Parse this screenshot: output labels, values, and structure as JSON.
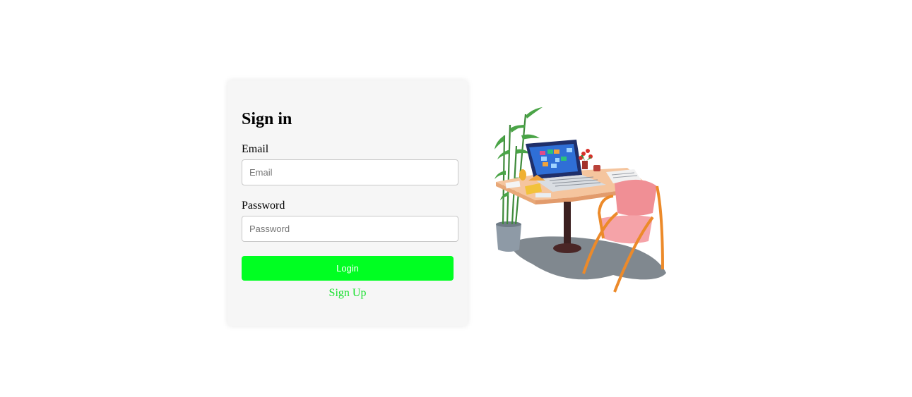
{
  "signin": {
    "title": "Sign in",
    "email_label": "Email",
    "email_placeholder": "Email",
    "email_value": "",
    "password_label": "Password",
    "password_placeholder": "Password",
    "password_value": "",
    "login_label": "Login",
    "signup_label": "Sign Up"
  },
  "colors": {
    "accent": "#00ff22",
    "link": "#18e02e",
    "card_bg": "#f6f6f6"
  },
  "illustration": {
    "icon": "desk-workspace-illustration"
  }
}
